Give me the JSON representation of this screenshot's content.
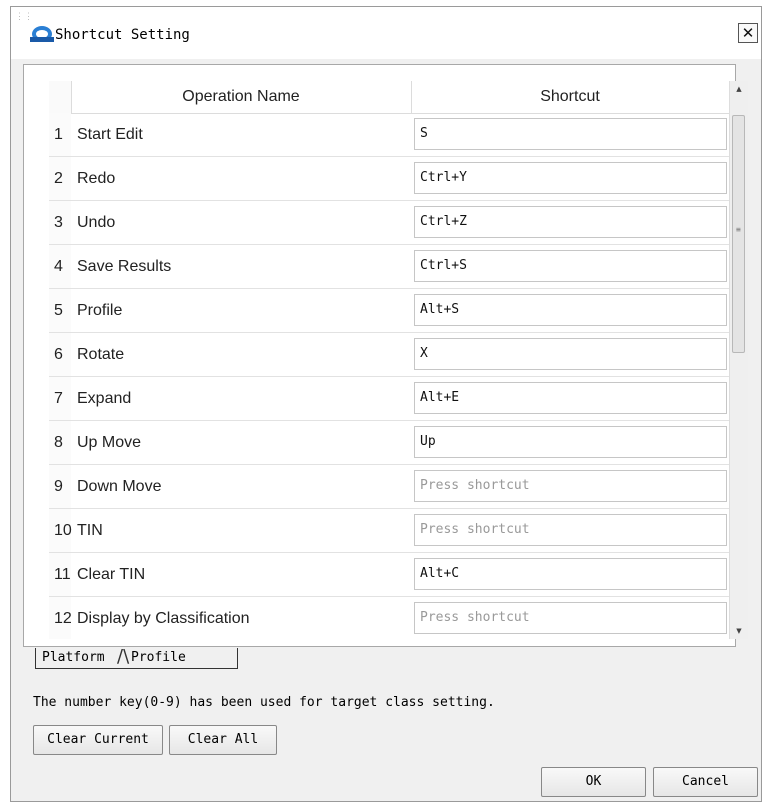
{
  "window": {
    "title": "Shortcut Setting",
    "close_glyph": "✕"
  },
  "table": {
    "headers": {
      "operation": "Operation Name",
      "shortcut": "Shortcut"
    },
    "rows": [
      {
        "num": "1",
        "name": "Start Edit",
        "shortcut": "S",
        "placeholder": ""
      },
      {
        "num": "2",
        "name": "Redo",
        "shortcut": "Ctrl+Y",
        "placeholder": ""
      },
      {
        "num": "3",
        "name": "Undo",
        "shortcut": "Ctrl+Z",
        "placeholder": ""
      },
      {
        "num": "4",
        "name": "Save Results",
        "shortcut": "Ctrl+S",
        "placeholder": ""
      },
      {
        "num": "5",
        "name": "Profile",
        "shortcut": "Alt+S",
        "placeholder": ""
      },
      {
        "num": "6",
        "name": "Rotate",
        "shortcut": "X",
        "placeholder": ""
      },
      {
        "num": "7",
        "name": "Expand",
        "shortcut": "Alt+E",
        "placeholder": ""
      },
      {
        "num": "8",
        "name": "Up Move",
        "shortcut": "Up",
        "placeholder": ""
      },
      {
        "num": "9",
        "name": "Down Move",
        "shortcut": "",
        "placeholder": "Press shortcut"
      },
      {
        "num": "10",
        "name": "TIN",
        "shortcut": "",
        "placeholder": "Press shortcut"
      },
      {
        "num": "11",
        "name": "Clear TIN",
        "shortcut": "Alt+C",
        "placeholder": ""
      },
      {
        "num": "12",
        "name": "Display by Classification",
        "shortcut": "",
        "placeholder": "Press shortcut"
      }
    ]
  },
  "tabs": [
    {
      "label": "Platform"
    },
    {
      "label": "Profile"
    }
  ],
  "info_text": "The number key(0-9) has been used for target class setting.",
  "buttons": {
    "clear_current": "Clear Current",
    "clear_all": "Clear All",
    "ok": "OK",
    "cancel": "Cancel"
  },
  "icons": {
    "logo": "app-logo-icon",
    "close": "close-icon",
    "scroll_up": "scroll-up-arrow-icon",
    "scroll_down": "scroll-down-arrow-icon"
  },
  "colors": {
    "dialog_bg": "#f0f0f0",
    "logo_blue": "#2a7fd4"
  }
}
